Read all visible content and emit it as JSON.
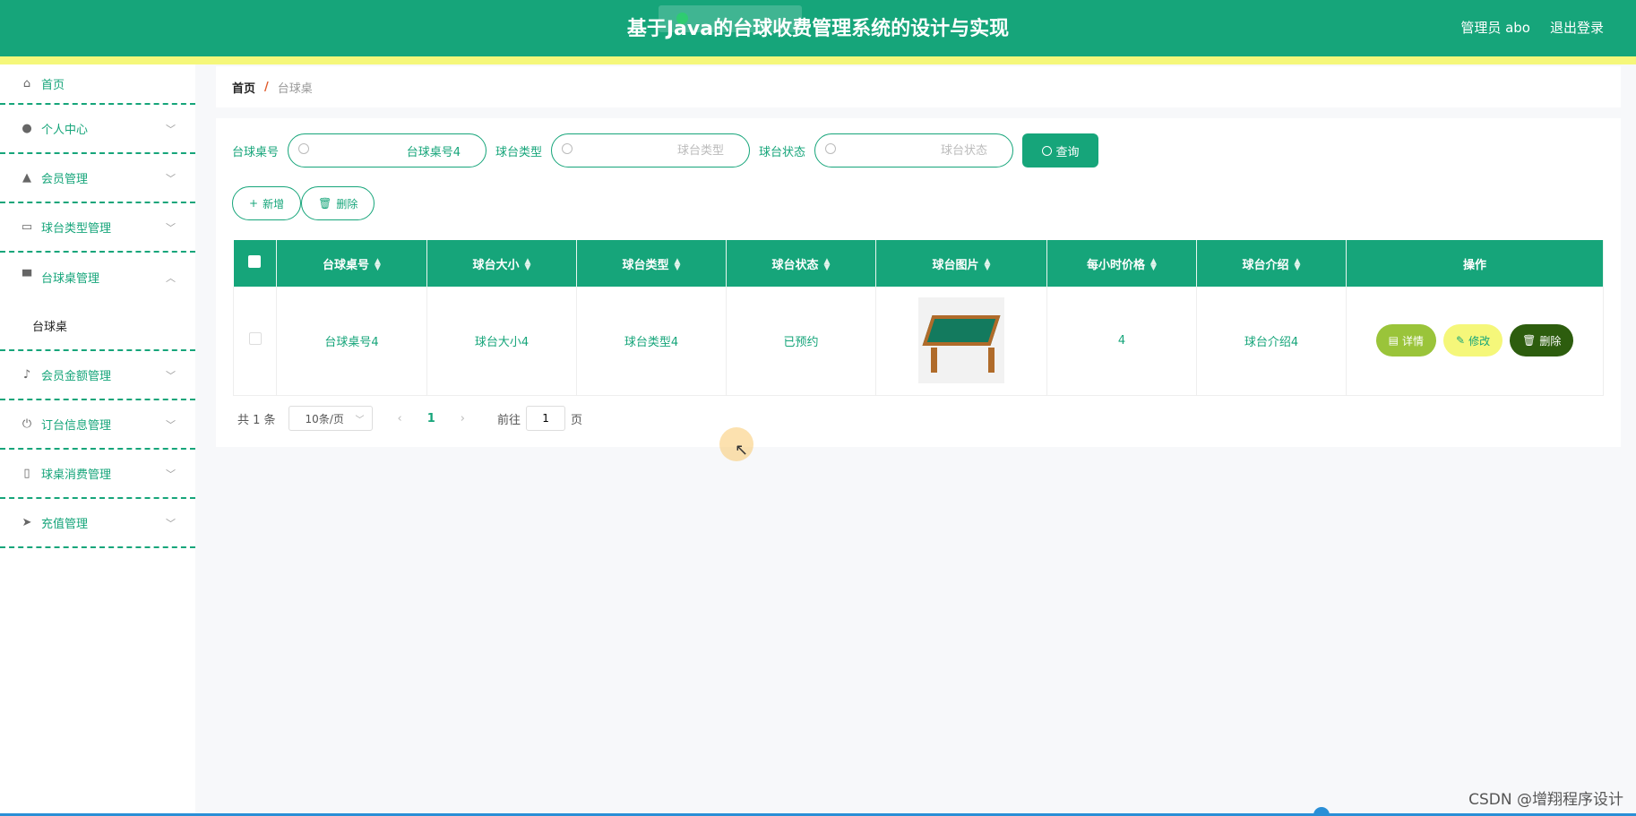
{
  "header": {
    "title": "基于Java的台球收费管理系统的设计与实现",
    "user_label": "管理员 abo",
    "logout_label": "退出登录"
  },
  "sidebar": {
    "items": [
      {
        "label": "首页",
        "icon": "home-icon"
      },
      {
        "label": "个人中心",
        "icon": "user-icon"
      },
      {
        "label": "会员管理",
        "icon": "member-icon"
      },
      {
        "label": "球台类型管理",
        "icon": "card-icon"
      },
      {
        "label": "台球桌管理",
        "icon": "table-icon",
        "open": true,
        "children": [
          {
            "label": "台球桌"
          }
        ]
      },
      {
        "label": "会员金额管理",
        "icon": "mic-icon"
      },
      {
        "label": "订台信息管理",
        "icon": "power-icon"
      },
      {
        "label": "球桌消费管理",
        "icon": "phone-icon"
      },
      {
        "label": "充值管理",
        "icon": "send-icon"
      }
    ]
  },
  "breadcrumb": {
    "home": "首页",
    "separator": "/",
    "current": "台球桌"
  },
  "search": {
    "fields": [
      {
        "label": "台球桌号",
        "value": "台球桌号4",
        "placeholder": "台球桌号"
      },
      {
        "label": "球台类型",
        "value": "",
        "placeholder": "球台类型"
      },
      {
        "label": "球台状态",
        "value": "",
        "placeholder": "球台状态"
      }
    ],
    "query_label": "查询"
  },
  "actions": {
    "add_label": "新增",
    "delete_label": "删除"
  },
  "table": {
    "columns": [
      "台球桌号",
      "球台大小",
      "球台类型",
      "球台状态",
      "球台图片",
      "每小时价格",
      "球台介绍",
      "操作"
    ],
    "rows": [
      {
        "number": "台球桌号4",
        "size": "球台大小4",
        "type": "球台类型4",
        "status": "已预约",
        "price": "4",
        "intro": "球台介绍4"
      }
    ],
    "row_actions": {
      "detail": "详情",
      "edit": "修改",
      "delete": "删除"
    }
  },
  "pagination": {
    "total": "共 1 条",
    "page_size": "10条/页",
    "current_page": "1",
    "goto_label": "前往",
    "goto_value": "1",
    "page_unit": "页"
  },
  "watermark": "CSDN @增翔程序设计",
  "colors": {
    "primary": "#16a57a",
    "accent_yellow": "#f5f77a",
    "detail_btn": "#9ac43a",
    "delete_btn": "#2d5d0e"
  }
}
